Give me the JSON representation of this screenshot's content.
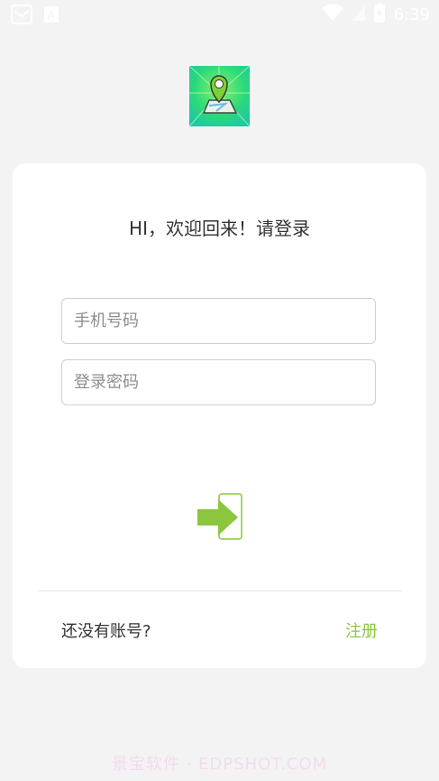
{
  "status_bar": {
    "time": "6:39",
    "icons": [
      "mail-icon",
      "notification-a-icon",
      "wifi-icon",
      "signal-icon",
      "battery-icon"
    ]
  },
  "app": {
    "logo": "map-location-logo"
  },
  "login": {
    "greeting": "HI，欢迎回来！请登录",
    "phone_placeholder": "手机号码",
    "password_placeholder": "登录密码",
    "submit_icon": "arrow-login-icon",
    "no_account_text": "还没有账号?",
    "register_label": "注册"
  },
  "colors": {
    "accent": "#8cc63e",
    "background": "#f3f3f3",
    "card": "#ffffff"
  },
  "watermark": "景宝软件 · EDPSHOT.COM"
}
